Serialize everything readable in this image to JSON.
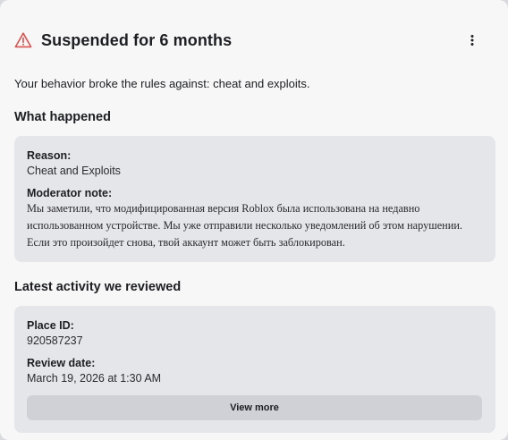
{
  "header": {
    "icon": "warning-triangle-icon",
    "title": "Suspended for 6 months",
    "menu_icon": "more-vertical-icon"
  },
  "summary": "Your behavior broke the rules against: cheat and exploits.",
  "what_happened": {
    "heading": "What happened",
    "reason_label": "Reason:",
    "reason_value": "Cheat and Exploits",
    "note_label": "Moderator note:",
    "note_text": "Мы заметили, что модифицированная версия Roblox была использована на недавно использованном устройстве. Мы уже отправили несколько уведомлений об этом нарушении. Если это произойдет снова, твой аккаунт может быть заблокирован."
  },
  "activity": {
    "heading": "Latest activity we reviewed",
    "place_label": "Place ID:",
    "place_value": "920587237",
    "date_label": "Review date:",
    "date_value": "March 19, 2026 at 1:30 AM",
    "view_more_label": "View more"
  },
  "colors": {
    "warning": "#d9534f",
    "card_bg": "#f7f7f8",
    "panel_bg": "#e5e6ea",
    "button_bg": "#cfd1d6"
  }
}
